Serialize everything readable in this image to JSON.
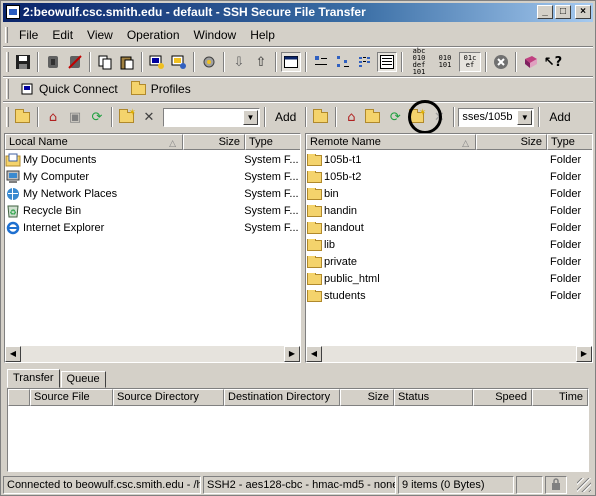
{
  "window": {
    "title": "2:beowulf.csc.smith.edu - default - SSH Secure File Transfer",
    "minimize_glyph": "_",
    "maximize_glyph": "□",
    "close_glyph": "×"
  },
  "menu": [
    "File",
    "Edit",
    "View",
    "Operation",
    "Window",
    "Help"
  ],
  "toolbar1": {
    "text_icon_1": "abc\n010\ndef\n101",
    "text_icon_2": "01c\nef"
  },
  "quickbar": {
    "quick_connect": "Quick Connect",
    "profiles": "Profiles"
  },
  "local": {
    "combo_value": "",
    "add_label": "Add",
    "columns": [
      "Local Name",
      "Size",
      "Type"
    ],
    "rows": [
      {
        "name": "My Documents",
        "size": "",
        "type": "System F...",
        "icon": "my-documents-icon"
      },
      {
        "name": "My Computer",
        "size": "",
        "type": "System F...",
        "icon": "my-computer-icon"
      },
      {
        "name": "My Network Places",
        "size": "",
        "type": "System F...",
        "icon": "network-places-icon"
      },
      {
        "name": "Recycle Bin",
        "size": "",
        "type": "System F...",
        "icon": "recycle-bin-icon"
      },
      {
        "name": "Internet Explorer",
        "size": "",
        "type": "System F...",
        "icon": "internet-explorer-icon"
      }
    ]
  },
  "remote": {
    "combo_value": "sses/105b",
    "add_label": "Add",
    "columns": [
      "Remote Name",
      "Size",
      "Type"
    ],
    "rows": [
      {
        "name": "105b-t1",
        "size": "",
        "type": "Folder"
      },
      {
        "name": "105b-t2",
        "size": "",
        "type": "Folder"
      },
      {
        "name": "bin",
        "size": "",
        "type": "Folder"
      },
      {
        "name": "handin",
        "size": "",
        "type": "Folder"
      },
      {
        "name": "handout",
        "size": "",
        "type": "Folder"
      },
      {
        "name": "lib",
        "size": "",
        "type": "Folder"
      },
      {
        "name": "private",
        "size": "",
        "type": "Folder"
      },
      {
        "name": "public_html",
        "size": "",
        "type": "Folder"
      },
      {
        "name": "students",
        "size": "",
        "type": "Folder"
      }
    ]
  },
  "transfer": {
    "tabs": [
      "Transfer",
      "Queue"
    ],
    "columns": [
      "",
      "Source File",
      "Source Directory",
      "Destination Directory",
      "Size",
      "Status",
      "Speed",
      "Time"
    ]
  },
  "statusbar": {
    "connection": "Connected to beowulf.csc.smith.edu - /h",
    "cipher": "SSH2 - aes128-cbc - hmac-md5 - none",
    "items": "9 items (0 Bytes)"
  }
}
